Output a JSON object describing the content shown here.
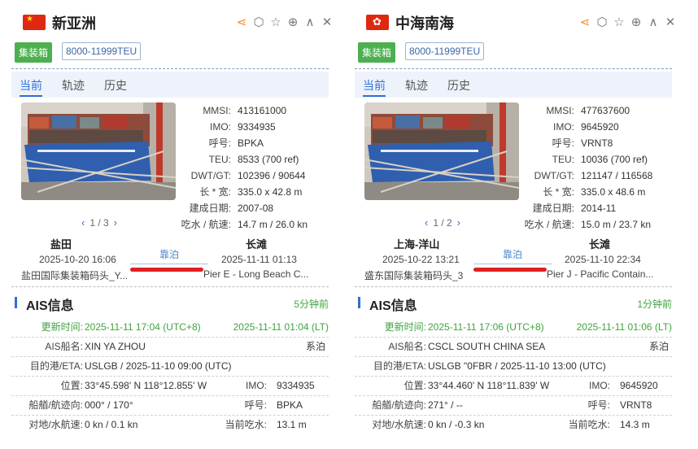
{
  "panels": [
    {
      "flag": "cn",
      "name": "新亚洲",
      "type_tag": "集装箱",
      "teu_range": "8000-11999TEU",
      "tabs": [
        "当前",
        "轨迹",
        "历史"
      ],
      "info": [
        {
          "label": "MMSI",
          "value": "413161000"
        },
        {
          "label": "IMO",
          "value": "9334935"
        },
        {
          "label": "呼号",
          "value": "BPKA"
        },
        {
          "label": "TEU",
          "value": "8533 (700 ref)"
        },
        {
          "label": "DWT/GT",
          "value": "102396 / 90644"
        },
        {
          "label": "长 * 宽",
          "value": "335.0 x 42.8 m"
        },
        {
          "label": "建成日期",
          "value": "2007-08"
        },
        {
          "label": "吃水 / 航速",
          "value": "14.7 m / 26.0 kn"
        }
      ],
      "pager": "1 / 3",
      "route": {
        "from_port": "盐田",
        "from_time": "2025-10-20 16:06",
        "from_berth": "盐田国际集装箱码头_Y...",
        "status": "靠泊",
        "to_port": "长滩",
        "to_time": "2025-11-11 01:13",
        "to_berth": "Pier E - Long Beach C..."
      },
      "ais": {
        "title": "AIS信息",
        "age": "5分钟前",
        "update_label": "更新时间",
        "update_utc": "2025-11-11 17:04 (UTC+8)",
        "update_lt": "2025-11-11 01:04 (LT)",
        "name_label": "AIS船名",
        "name_value": "XIN YA ZHOU",
        "nav_status": "系泊",
        "dest_label": "目的港/ETA",
        "dest_value": "USLGB / 2025-11-10 09:00 (UTC)",
        "pos_label": "位置",
        "pos_value": "33°45.598' N   118°12.855' W",
        "imo_label": "IMO",
        "imo_value": "9334935",
        "heading_label": "船艏/航迹向",
        "heading_value": "000° / 170°",
        "call_label": "呼号",
        "call_value": "BPKA",
        "speed_label": "对地/水航速",
        "speed_value": "0 kn / 0.1 kn",
        "draft_label": "当前吃水",
        "draft_value": "13.1 m"
      }
    },
    {
      "flag": "hk",
      "name": "中海南海",
      "type_tag": "集装箱",
      "teu_range": "8000-11999TEU",
      "tabs": [
        "当前",
        "轨迹",
        "历史"
      ],
      "info": [
        {
          "label": "MMSI",
          "value": "477637600"
        },
        {
          "label": "IMO",
          "value": "9645920"
        },
        {
          "label": "呼号",
          "value": "VRNT8"
        },
        {
          "label": "TEU",
          "value": "10036 (700 ref)"
        },
        {
          "label": "DWT/GT",
          "value": "121147 / 116568"
        },
        {
          "label": "长 * 宽",
          "value": "335.0 x 48.6 m"
        },
        {
          "label": "建成日期",
          "value": "2014-11"
        },
        {
          "label": "吃水 / 航速",
          "value": "15.0 m / 23.7 kn"
        }
      ],
      "pager": "1 / 2",
      "route": {
        "from_port": "上海-洋山",
        "from_time": "2025-10-22 13:21",
        "from_berth": "盛东国际集装箱码头_3",
        "status": "靠泊",
        "to_port": "长滩",
        "to_time": "2025-11-10 22:34",
        "to_berth": "Pier J - Pacific Contain..."
      },
      "ais": {
        "title": "AIS信息",
        "age": "1分钟前",
        "update_label": "更新时间",
        "update_utc": "2025-11-11 17:06 (UTC+8)",
        "update_lt": "2025-11-11 01:06 (LT)",
        "name_label": "AIS船名",
        "name_value": "CSCL SOUTH CHINA SEA",
        "nav_status": "系泊",
        "dest_label": "目的港/ETA",
        "dest_value": "USLGB \"0FBR / 2025-11-10 13:00 (UTC)",
        "pos_label": "位置",
        "pos_value": "33°44.460' N   118°11.839' W",
        "imo_label": "IMO",
        "imo_value": "9645920",
        "heading_label": "船艏/航迹向",
        "heading_value": "271° / --",
        "call_label": "呼号",
        "call_value": "VRNT8",
        "speed_label": "对地/水航速",
        "speed_value": "0 kn / -0.3 kn",
        "draft_label": "当前吃水",
        "draft_value": "14.3 m"
      }
    }
  ]
}
